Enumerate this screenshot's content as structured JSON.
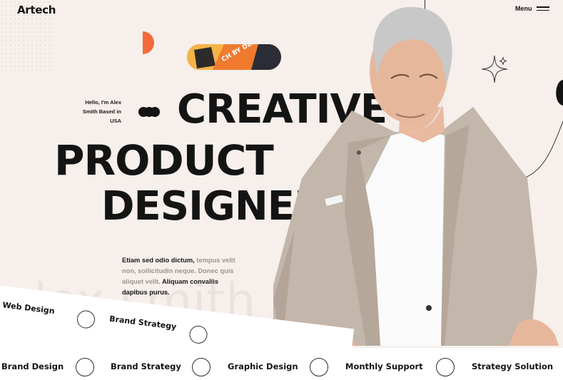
{
  "header": {
    "logo": "Artech",
    "menu_label": "Menu"
  },
  "hero": {
    "intro": "Hello, I'm Alex Smith Based in USA",
    "headline_1": "CREATIVE",
    "headline_2": "PRODUCT",
    "headline_3": "DESIGNER",
    "pill_text": "CH BY DESIG",
    "description": {
      "part_1": "Etiam sed odio dictum, ",
      "part_2": "tempus velit non, sollicitudin neque. Donec quis aliquet velit. ",
      "part_3": "Aliquam convallis dapibus purus."
    },
    "background_name": "alex smith"
  },
  "tilted_marquee": {
    "items": [
      "Web Design",
      "Brand Strategy"
    ]
  },
  "bottom_marquee": {
    "items": [
      "Brand Design",
      "Brand Strategy",
      "Graphic Design",
      "Monthly Support",
      "Strategy Solution"
    ]
  },
  "colors": {
    "background": "#f6efeb",
    "accent": "#f26b3a",
    "text": "#141414"
  }
}
